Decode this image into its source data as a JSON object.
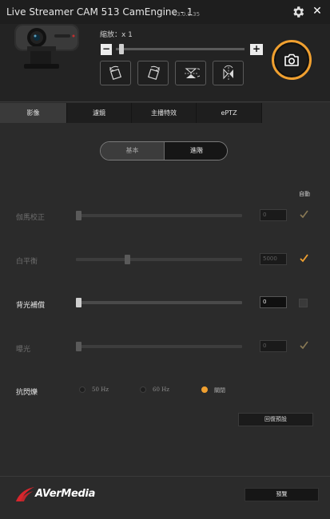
{
  "titlebar": {
    "title": "Live Streamer CAM 513 CamEngine - 1",
    "version": "v3.0.0.35",
    "close_glyph": "✕"
  },
  "zoom": {
    "label": "縮放：x 1",
    "minus": "−",
    "plus": "+",
    "level": 0.02
  },
  "tabs": [
    {
      "label": "影像",
      "active": true
    },
    {
      "label": "濾鏡",
      "active": false
    },
    {
      "label": "主播特效",
      "active": false
    },
    {
      "label": "ePTZ",
      "active": false
    }
  ],
  "mode": {
    "basic": "基本",
    "advanced": "進階",
    "selected": "進階"
  },
  "auto_header": "自動",
  "settings": [
    {
      "label": "伽馬校正",
      "value": "0",
      "enabled": false,
      "auto": true,
      "level": 0.0
    },
    {
      "label": "白平衡",
      "value": "5000",
      "enabled": false,
      "auto": true,
      "level": 0.3
    },
    {
      "label": "背光補償",
      "value": "0",
      "enabled": true,
      "auto": false,
      "level": 0.0
    },
    {
      "label": "曝光",
      "value": "0",
      "enabled": false,
      "auto": true,
      "level": 0.0
    }
  ],
  "flicker": {
    "label": "抗閃爍",
    "options": [
      "50 Hz",
      "60 Hz",
      "關閉"
    ],
    "selected": "關閉"
  },
  "restore_label": "回復預設",
  "preview_label": "預覽",
  "brand": {
    "logo_text": "AVerMedia"
  },
  "colors": {
    "accent": "#f0a030",
    "background": "#2b2b2b",
    "titlebar": "#1e1e1e"
  },
  "icons": {
    "settings": "gear-icon",
    "close": "close-icon",
    "snapshot": "camera-icon",
    "rotate_left": "rotate-left-icon",
    "rotate_right": "rotate-right-icon",
    "flip_vertical": "flip-vertical-icon",
    "mirror_horizontal": "mirror-horizontal-icon",
    "auto_check": "checkmark-icon"
  }
}
